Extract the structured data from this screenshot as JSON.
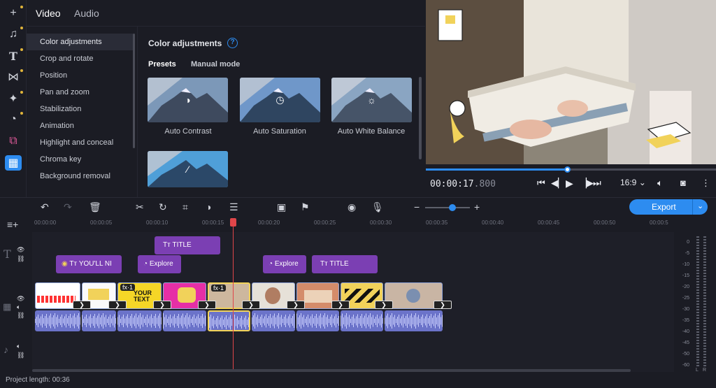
{
  "tabs": {
    "video": "Video",
    "audio": "Audio"
  },
  "menu": [
    "Color adjustments",
    "Crop and rotate",
    "Position",
    "Pan and zoom",
    "Stabilization",
    "Animation",
    "Highlight and conceal",
    "Chroma key",
    "Background removal"
  ],
  "panel": {
    "title": "Color adjustments",
    "help": "?",
    "subtab_presets": "Presets",
    "subtab_manual": "Manual mode"
  },
  "presets": [
    "Auto Contrast",
    "Auto Saturation",
    "Auto White Balance",
    ""
  ],
  "player": {
    "time_main": "00:00:17",
    "time_ms": ".800",
    "aspect": "16:9",
    "progress": 0.49
  },
  "toolbar": {
    "export": "Export"
  },
  "ruler": [
    "00:00:00",
    "00:00:05",
    "00:00:10",
    "00:00:15",
    "00:00:20",
    "00:00:25",
    "00:00:30",
    "00:00:35",
    "00:00:40",
    "00:00:45",
    "00:00:50",
    "00:00:5"
  ],
  "titles": {
    "t1": "TITLE",
    "t2": "YOU'LL NI",
    "t3": "Explore",
    "t4": "Explore",
    "t5": "TITLE"
  },
  "fx": {
    "a": "fx·1",
    "b": "fx·1"
  },
  "thumb_text": {
    "your_text": "YOUR\nTEXT"
  },
  "status": "Project length: 00:36",
  "meter_labels": [
    "0",
    "-5",
    "-10",
    "-15",
    "-20",
    "-25",
    "-30",
    "-35",
    "-40",
    "-45",
    "-50",
    "-60"
  ],
  "meter_lr": {
    "l": "L",
    "r": "R"
  },
  "colors": {
    "accent": "#2d8cf0",
    "title_clip": "#7b3fb3",
    "playhead": "#e0464a"
  }
}
